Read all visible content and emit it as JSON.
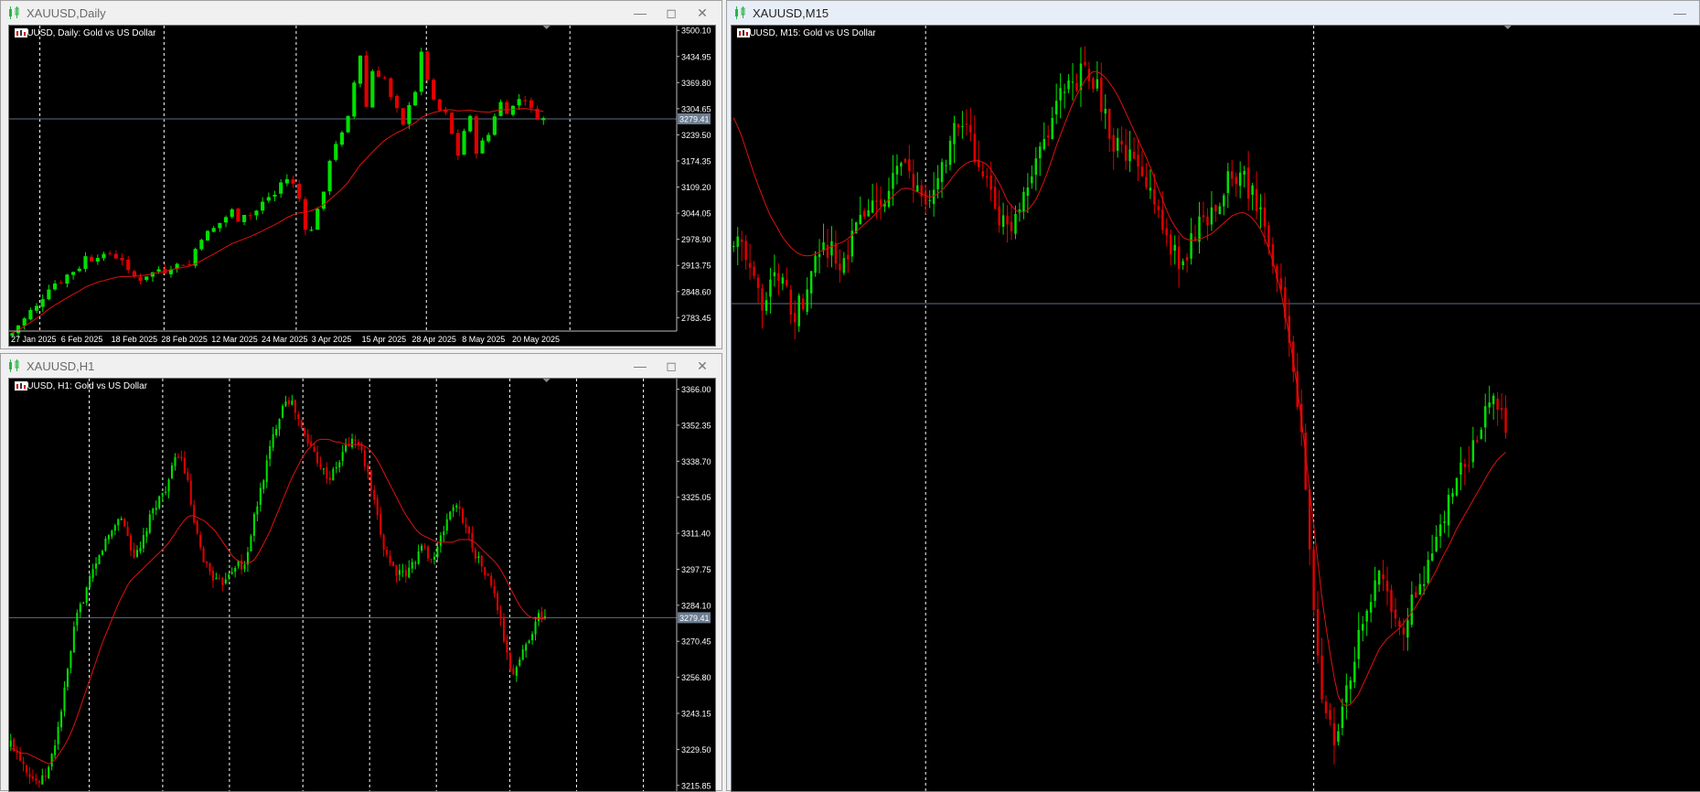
{
  "colors": {
    "background": "#000000",
    "bull": "#00e000",
    "bear": "#e00000",
    "ma": "#e01010",
    "axis_text": "#ffffff",
    "grid": "#ffffff",
    "price_line": "#5a6f86",
    "price_tag_bg": "#6c7d91"
  },
  "current_price": "3279.41",
  "windows": {
    "daily": {
      "title": "XAUUSD,Daily",
      "chart_label": "XAUUSD, Daily:  Gold vs US Dollar",
      "price_ticks": [
        "3500.10",
        "3434.95",
        "3369.80",
        "3304.65",
        "3239.50",
        "3174.35",
        "3109.20",
        "3044.05",
        "2978.90",
        "2913.75",
        "2848.60",
        "2783.45"
      ],
      "date_ticks": [
        "27 Jan 2025",
        "6 Feb 2025",
        "18 Feb 2025",
        "28 Feb 2025",
        "12 Mar 2025",
        "24 Mar 2025",
        "3 Apr 2025",
        "15 Apr 2025",
        "28 Apr 2025",
        "8 May 2025",
        "20 May 2025"
      ]
    },
    "h1": {
      "title": "XAUUSD,H1",
      "chart_label": "XAUUSD, H1:  Gold vs US Dollar",
      "price_ticks": [
        "3366.00",
        "3352.35",
        "3338.70",
        "3325.05",
        "3311.40",
        "3297.75",
        "3284.10",
        "3270.45",
        "3256.80",
        "3243.15",
        "3229.50",
        "3215.85"
      ]
    },
    "m15": {
      "title": "XAUUSD,M15",
      "chart_label": "XAUUSD, M15:  Gold vs US Dollar"
    }
  },
  "chart_data": [
    {
      "type": "candlestick",
      "title": "XAUUSD, Daily:  Gold vs US Dollar",
      "ylim": [
        2750,
        3512
      ],
      "x_labels": [
        "27 Jan 2025",
        "6 Feb 2025",
        "18 Feb 2025",
        "28 Feb 2025",
        "12 Mar 2025",
        "24 Mar 2025",
        "3 Apr 2025",
        "15 Apr 2025",
        "28 Apr 2025",
        "8 May 2025",
        "20 May 2025"
      ],
      "close_path": [
        2745,
        2765,
        2780,
        2800,
        2810,
        2835,
        2860,
        2870,
        2875,
        2890,
        2900,
        2910,
        2935,
        2930,
        2940,
        2935,
        2945,
        2935,
        2930,
        2895,
        2885,
        2880,
        2890,
        2895,
        2905,
        2900,
        2912,
        2915,
        2920,
        2915,
        2955,
        2985,
        2995,
        3005,
        3020,
        3035,
        3050,
        3030,
        3045,
        3040,
        3050,
        3070,
        3085,
        3090,
        3120,
        3130,
        3115,
        3080,
        3010,
        3000,
        3060,
        3090,
        3180,
        3220,
        3240,
        3280,
        3370,
        3440,
        3310,
        3400,
        3390,
        3380,
        3330,
        3300,
        3260,
        3320,
        3350,
        3440,
        3380,
        3320,
        3300,
        3290,
        3240,
        3190,
        3250,
        3280,
        3200,
        3220,
        3240,
        3290,
        3320,
        3300,
        3310,
        3330,
        3330,
        3300,
        3285,
        3279
      ],
      "ma_path": [
        2745,
        2752,
        2762,
        2772,
        2782,
        2793,
        2805,
        2815,
        2824,
        2833,
        2842,
        2850,
        2860,
        2866,
        2872,
        2876,
        2880,
        2884,
        2886,
        2886,
        2887,
        2888,
        2890,
        2893,
        2896,
        2899,
        2903,
        2906,
        2909,
        2912,
        2918,
        2926,
        2934,
        2942,
        2951,
        2960,
        2968,
        2974,
        2980,
        2986,
        2993,
        3000,
        3008,
        3015,
        3024,
        3033,
        3040,
        3045,
        3047,
        3050,
        3057,
        3065,
        3078,
        3091,
        3105,
        3121,
        3143,
        3165,
        3180,
        3197,
        3212,
        3226,
        3236,
        3245,
        3252,
        3261,
        3270,
        3283,
        3290,
        3295,
        3299,
        3302,
        3302,
        3299,
        3300,
        3301,
        3298,
        3297,
        3296,
        3299,
        3302,
        3302,
        3303,
        3305,
        3305,
        3303,
        3300,
        3298
      ],
      "grid_x_fraction": [
        0.046,
        0.232,
        0.43,
        0.625,
        0.84
      ]
    },
    {
      "type": "candlestick",
      "title": "XAUUSD, H1:  Gold vs US Dollar",
      "ylim": [
        3213,
        3370
      ],
      "close_path": [
        3232,
        3229,
        3226,
        3222,
        3219,
        3217,
        3218,
        3222,
        3230,
        3240,
        3252,
        3265,
        3278,
        3284,
        3290,
        3295,
        3300,
        3306,
        3310,
        3313,
        3318,
        3315,
        3308,
        3302,
        3305,
        3312,
        3318,
        3323,
        3326,
        3330,
        3336,
        3342,
        3337,
        3328,
        3314,
        3306,
        3300,
        3297,
        3293,
        3292,
        3296,
        3298,
        3301,
        3296,
        3306,
        3316,
        3325,
        3334,
        3343,
        3351,
        3358,
        3363,
        3361,
        3356,
        3350,
        3346,
        3343,
        3339,
        3335,
        3332,
        3335,
        3339,
        3344,
        3346,
        3347,
        3342,
        3335,
        3326,
        3316,
        3307,
        3302,
        3298,
        3296,
        3295,
        3298,
        3302,
        3306,
        3305,
        3301,
        3305,
        3311,
        3318,
        3322,
        3320,
        3316,
        3310,
        3304,
        3300,
        3296,
        3292,
        3285,
        3276,
        3264,
        3258,
        3262,
        3267,
        3272,
        3276,
        3281,
        3279
      ],
      "ma_path": [
        3230,
        3229,
        3228,
        3228,
        3227,
        3226,
        3225,
        3224,
        3225,
        3228,
        3231,
        3235,
        3240,
        3246,
        3252,
        3258,
        3264,
        3270,
        3275,
        3280,
        3285,
        3289,
        3293,
        3295,
        3297,
        3299,
        3301,
        3303,
        3305,
        3307,
        3310,
        3313,
        3316,
        3318,
        3318,
        3317,
        3316,
        3314,
        3312,
        3309,
        3306,
        3303,
        3301,
        3300,
        3300,
        3301,
        3304,
        3308,
        3312,
        3317,
        3322,
        3327,
        3332,
        3336,
        3340,
        3343,
        3345,
        3347,
        3347,
        3347,
        3346,
        3346,
        3345,
        3345,
        3345,
        3345,
        3344,
        3342,
        3339,
        3335,
        3331,
        3327,
        3323,
        3319,
        3316,
        3313,
        3311,
        3310,
        3309,
        3308,
        3308,
        3308,
        3308,
        3309,
        3309,
        3309,
        3308,
        3306,
        3304,
        3302,
        3300,
        3297,
        3293,
        3289,
        3285,
        3282,
        3280,
        3279,
        3279,
        3279
      ],
      "grid_x_fraction": [
        0.12,
        0.23,
        0.33,
        0.44,
        0.54,
        0.64,
        0.75,
        0.85,
        0.95
      ]
    },
    {
      "type": "candlestick",
      "title": "XAUUSD, M15:  Gold vs US Dollar",
      "ylim": [
        3120,
        3370
      ],
      "close_path": [
        3302,
        3298,
        3290,
        3284,
        3281,
        3283,
        3288,
        3286,
        3279,
        3277,
        3282,
        3289,
        3295,
        3300,
        3296,
        3290,
        3296,
        3302,
        3305,
        3309,
        3312,
        3313,
        3317,
        3320,
        3324,
        3322,
        3317,
        3309,
        3313,
        3319,
        3326,
        3332,
        3338,
        3335,
        3331,
        3325,
        3319,
        3312,
        3306,
        3302,
        3307,
        3314,
        3320,
        3326,
        3331,
        3338,
        3343,
        3349,
        3351,
        3353,
        3356,
        3355,
        3347,
        3340,
        3333,
        3329,
        3327,
        3325,
        3321,
        3317,
        3311,
        3306,
        3300,
        3295,
        3294,
        3298,
        3304,
        3306,
        3309,
        3314,
        3318,
        3321,
        3322,
        3318,
        3314,
        3308,
        3302,
        3294,
        3285,
        3270,
        3255,
        3232,
        3200,
        3170,
        3150,
        3140,
        3135,
        3148,
        3160,
        3172,
        3180,
        3188,
        3190,
        3184,
        3176,
        3172,
        3177,
        3184,
        3190,
        3195,
        3200,
        3207,
        3215,
        3221,
        3226,
        3232,
        3238,
        3245,
        3250,
        3244,
        3240
      ],
      "ma_path": [
        3340,
        3335,
        3328,
        3321,
        3315,
        3309,
        3305,
        3301,
        3298,
        3296,
        3295,
        3295,
        3296,
        3297,
        3298,
        3299,
        3300,
        3302,
        3304,
        3306,
        3308,
        3311,
        3313,
        3315,
        3317,
        3317,
        3316,
        3315,
        3314,
        3315,
        3317,
        3320,
        3323,
        3325,
        3326,
        3326,
        3325,
        3322,
        3318,
        3313,
        3310,
        3309,
        3310,
        3313,
        3318,
        3324,
        3331,
        3337,
        3343,
        3348,
        3352,
        3355,
        3355,
        3353,
        3350,
        3346,
        3341,
        3336,
        3331,
        3326,
        3320,
        3314,
        3308,
        3304,
        3301,
        3300,
        3300,
        3301,
        3302,
        3304,
        3306,
        3308,
        3309,
        3309,
        3307,
        3304,
        3299,
        3292,
        3283,
        3271,
        3257,
        3240,
        3220,
        3200,
        3180,
        3165,
        3152,
        3148,
        3149,
        3152,
        3157,
        3162,
        3167,
        3170,
        3172,
        3174,
        3177,
        3180,
        3184,
        3188,
        3192,
        3197,
        3201,
        3206,
        3210,
        3214,
        3218,
        3222,
        3226,
        3229,
        3231
      ],
      "grid_x_fraction": [
        0.2,
        0.6
      ]
    }
  ]
}
